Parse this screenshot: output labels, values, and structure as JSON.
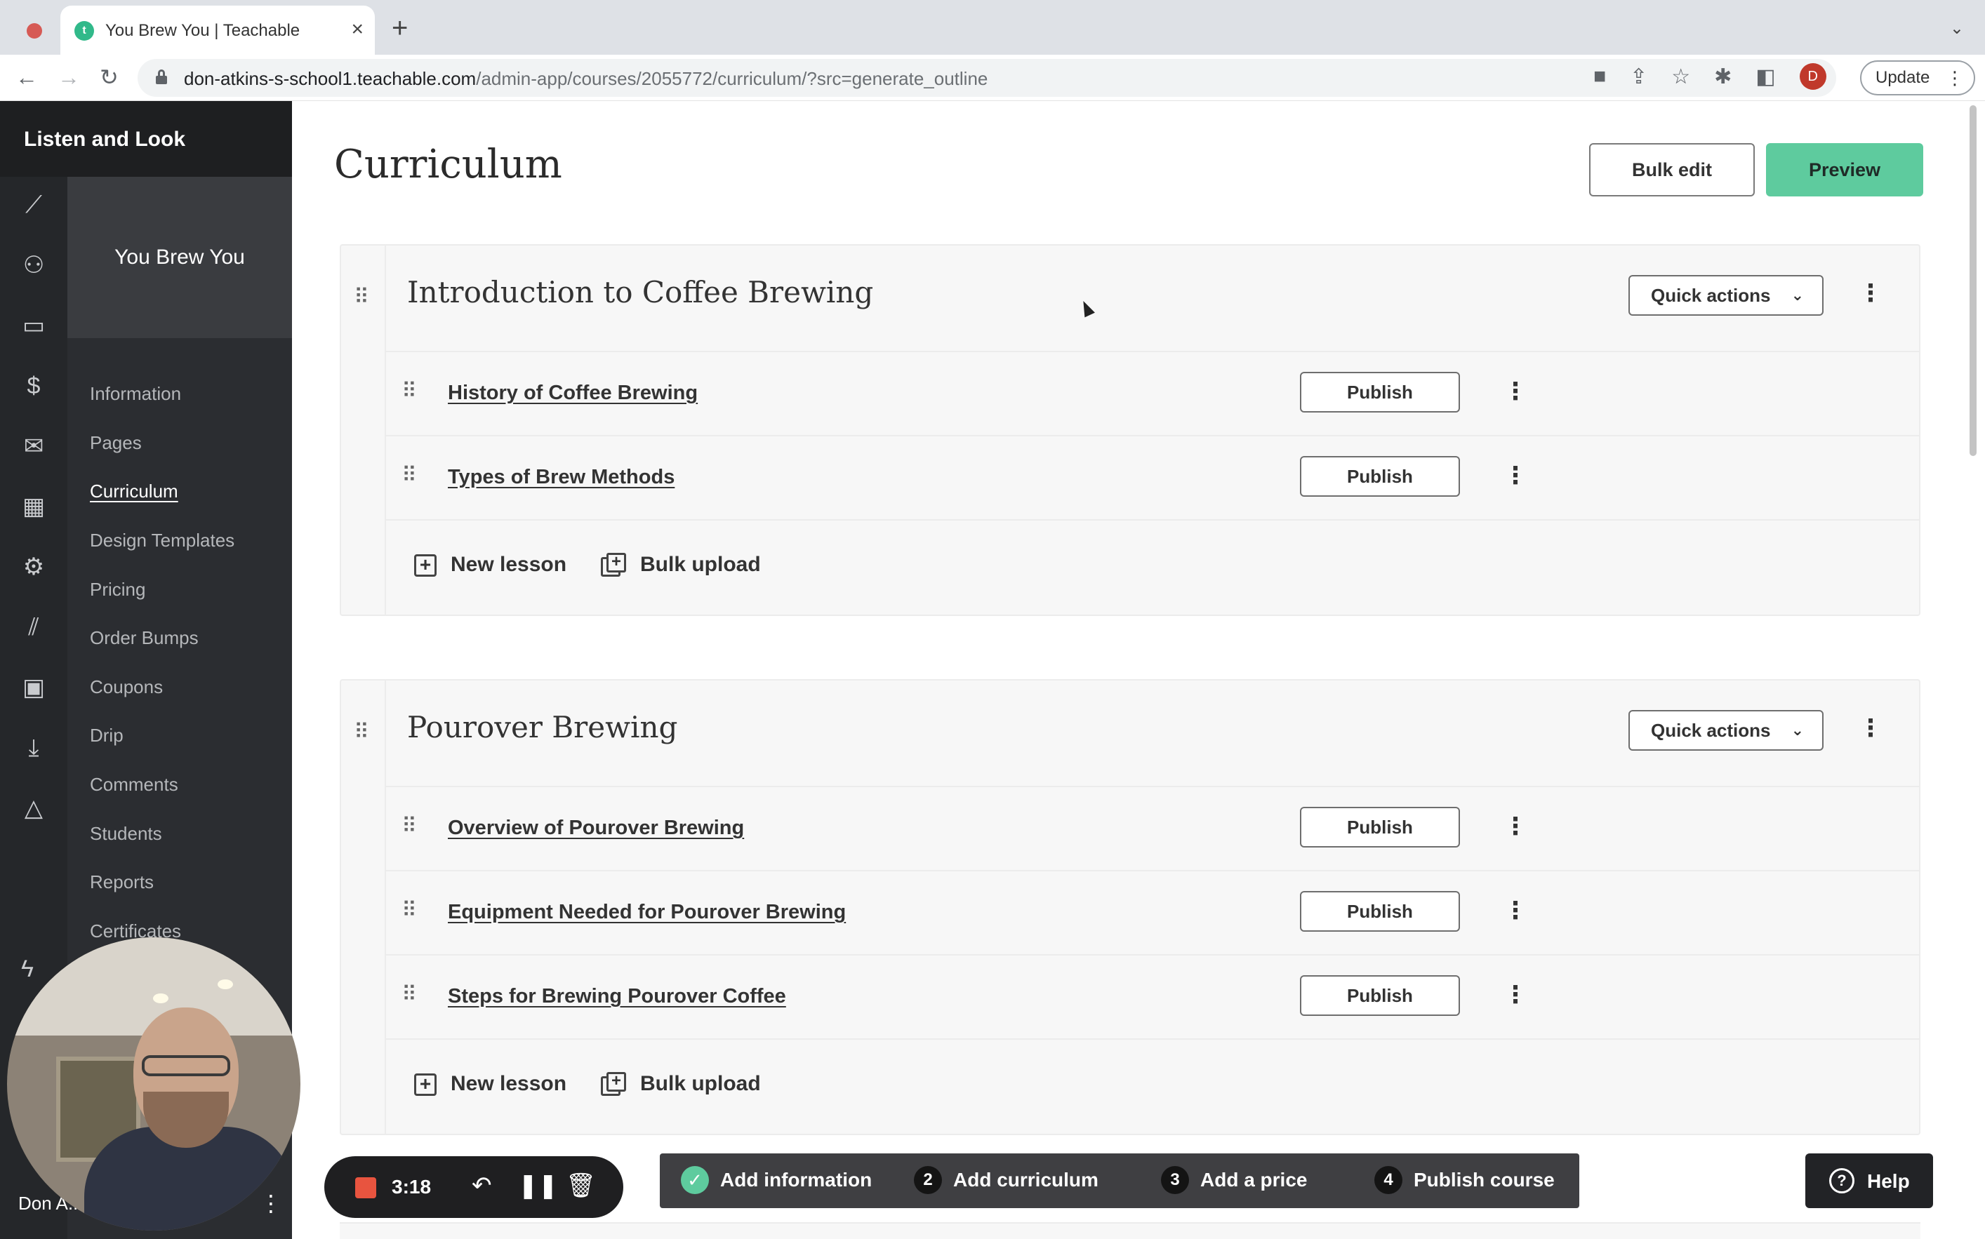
{
  "browser": {
    "tab_title": "You Brew You | Teachable",
    "tab_favicon_letter": "t",
    "tab_close": "×",
    "tab_new": "+",
    "url_host": "don-atkins-s-school1.teachable.com",
    "url_path": "/admin-app/courses/2055772/curriculum/?src=generate_outline",
    "profile_initial": "D",
    "update_label": "Update"
  },
  "school": {
    "name": "Listen and Look"
  },
  "rail_icons": [
    "chart-icon",
    "users-icon",
    "devices-icon",
    "dollar-icon",
    "mail-icon",
    "grid-icon",
    "gear-icon",
    "library-icon",
    "calendar-icon",
    "download-icon",
    "shapes-icon"
  ],
  "course": {
    "name": "You Brew You",
    "menu": [
      {
        "label": "Information",
        "active": false
      },
      {
        "label": "Pages",
        "active": false
      },
      {
        "label": "Curriculum",
        "active": true
      },
      {
        "label": "Design Templates",
        "active": false
      },
      {
        "label": "Pricing",
        "active": false
      },
      {
        "label": "Order Bumps",
        "active": false
      },
      {
        "label": "Coupons",
        "active": false
      },
      {
        "label": "Drip",
        "active": false
      },
      {
        "label": "Comments",
        "active": false
      },
      {
        "label": "Students",
        "active": false
      },
      {
        "label": "Reports",
        "active": false
      },
      {
        "label": "Certificates",
        "active": false
      }
    ]
  },
  "user": {
    "name": "Don A..."
  },
  "page": {
    "title": "Curriculum",
    "bulk_edit_label": "Bulk edit",
    "preview_label": "Preview"
  },
  "chapters": [
    {
      "title": "Introduction to Coffee Brewing",
      "quick_actions_label": "Quick actions",
      "lessons": [
        {
          "title": "History of Coffee Brewing",
          "publish_label": "Publish"
        },
        {
          "title": "Types of Brew Methods",
          "publish_label": "Publish"
        }
      ],
      "new_lesson_label": "New lesson",
      "bulk_upload_label": "Bulk upload"
    },
    {
      "title": "Pourover Brewing",
      "quick_actions_label": "Quick actions",
      "lessons": [
        {
          "title": "Overview of Pourover Brewing",
          "publish_label": "Publish"
        },
        {
          "title": "Equipment Needed for Pourover Brewing",
          "publish_label": "Publish"
        },
        {
          "title": "Steps for Brewing Pourover Coffee",
          "publish_label": "Publish"
        }
      ],
      "new_lesson_label": "New lesson",
      "bulk_upload_label": "Bulk upload"
    }
  ],
  "recording": {
    "time": "3:18"
  },
  "setup_steps": [
    {
      "number": "✓",
      "label": "Add information",
      "done": true
    },
    {
      "number": "2",
      "label": "Add curriculum",
      "done": false
    },
    {
      "number": "3",
      "label": "Add a price",
      "done": false
    },
    {
      "number": "4",
      "label": "Publish course",
      "done": false
    }
  ],
  "help": {
    "label": "Help",
    "icon": "?"
  },
  "colors": {
    "accent_green": "#5ecb9e",
    "sidebar_dark": "#2b2d31",
    "recording_red": "#e8543f"
  }
}
